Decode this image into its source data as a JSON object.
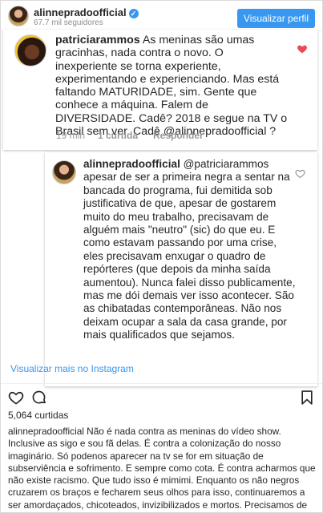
{
  "header": {
    "username": "alinnepradoofficial",
    "followers": "67.7 mil seguidores",
    "view_profile": "Visualizar perfil"
  },
  "comment1": {
    "username": "patriciarammos",
    "text": " As meninas são umas gracinhas, nada contra o novo. O inexperiente se torna experiente, experimentando e experienciando. Mas está faltando MATURIDADE, sim. Gente que conhece a máquina. Falem de DIVERSIDADE. Cadê? 2018 e segue na TV o Brasil sem ver. Cadê @alinnepradoofficial ?",
    "time": "19 min",
    "likes": "1 curtida",
    "reply": "Responder"
  },
  "reply": {
    "username": "alinnepradoofficial",
    "text": " @patriciarammos apesar de ser a primeira negra a sentar na bancada do programa, fui demitida sob justificativa de que, apesar de gostarem muito do meu trabalho, precisavam de alguém mais \"neutro\" (sic) do que eu.  E como estavam passando por uma crise, eles precisavam enxugar o quadro de repórteres (que depois da minha saída aumentou).  Nunca falei disso publicamente, mas me dói demais ver isso acontecer.  São as chibatadas contemporâneas.  Não nos deixam ocupar a sala da casa grande, por mais qualificados que sejamos."
  },
  "more_link": "Visualizar mais no Instagram",
  "likes_count": "5,064 curtidas",
  "caption": {
    "username": "alinnepradoofficial",
    "text": " Não é nada contra as meninas do vídeo show. Inclusive as sigo e sou fã delas. É contra a colonização do nosso imaginário. Só podenos aparecer na tv se for em situação de subserviência e sofrimento. E sempre como cota. É contra acharmos que não existe racismo. Que tudo isso é mimimi. Enquanto os não negros cruzarem os braços e fecharem seus olhos para isso, continuaremos a ser amordaçados, chicoteados, invizibilizados e mortos. Precisamos de aliados nessa luta. Precisamos de você!"
  },
  "icons": [
    "verified-badge-icon",
    "heart-icon",
    "comment-icon",
    "bookmark-icon"
  ],
  "colors": {
    "accent": "#3897f0",
    "heart": "#ed4956",
    "muted": "#8e8e8e"
  }
}
